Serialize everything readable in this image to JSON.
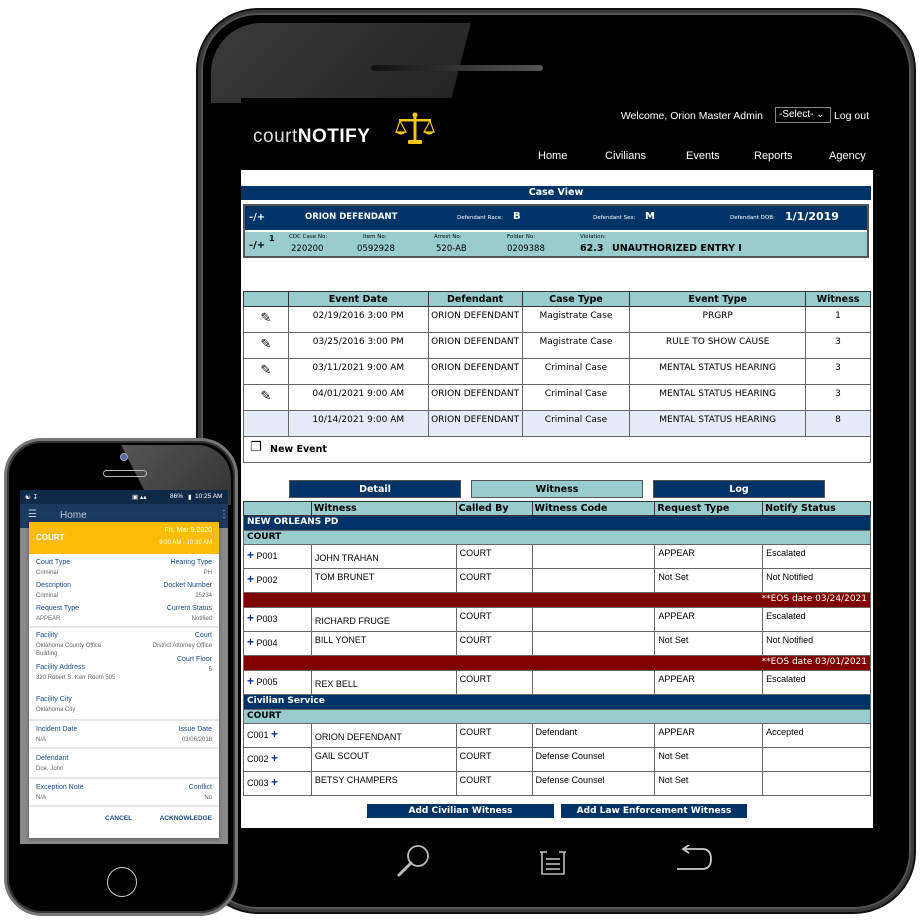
{
  "tablet": {
    "header": {
      "logo_light": "court",
      "logo_bold": "NOTIFY",
      "welcome": "Welcome, Orion Master Admin",
      "select_value": "-Select-",
      "logout": "Log out",
      "nav": [
        "Home",
        "Civilians",
        "Events",
        "Reports",
        "Agency"
      ]
    },
    "case_view": {
      "title": "Case View",
      "toggle": "-/+",
      "defendant_name": "ORION DEFENDANT",
      "race_label": "Defendant Race:",
      "race_value": "B",
      "sex_label": "Defendant Sex:",
      "sex_value": "M",
      "dob_label": "Defendant DOB:",
      "dob_value": "1/1/2019",
      "charge_toggle": "-/+",
      "charge_index": "1",
      "cdc_label": "CDC Case No:",
      "cdc_value": "220200",
      "item_label": "Item No:",
      "item_value": "0592928",
      "arrest_label": "Arrest No:",
      "arrest_value": "520-AB",
      "folder_label": "Folder No:",
      "folder_value": "0209388",
      "violation_label": "Violation:",
      "violation_code": "62.3",
      "violation_desc": "UNAUTHORIZED ENTRY I"
    },
    "events": {
      "columns": [
        "",
        "Event Date",
        "Defendant",
        "Case Type",
        "Event Type",
        "Witness"
      ],
      "rows": [
        {
          "date": "02/19/2016 3:00 PM",
          "defendant": "ORION DEFENDANT",
          "case_type": "Magistrate Case",
          "event_type": "PRGRP",
          "witness": "1",
          "editable": true
        },
        {
          "date": "03/25/2016 3:00 PM",
          "defendant": "ORION DEFENDANT",
          "case_type": "Magistrate Case",
          "event_type": "RULE TO SHOW CAUSE",
          "witness": "3",
          "editable": true
        },
        {
          "date": "03/11/2021 9:00 AM",
          "defendant": "ORION DEFENDANT",
          "case_type": "Criminal Case",
          "event_type": "MENTAL STATUS HEARING",
          "witness": "3",
          "editable": true
        },
        {
          "date": "04/01/2021 9:00 AM",
          "defendant": "ORION DEFENDANT",
          "case_type": "Criminal Case",
          "event_type": "MENTAL STATUS HEARING",
          "witness": "3",
          "editable": true
        },
        {
          "date": "10/14/2021 9:00 AM",
          "defendant": "ORION DEFENDANT",
          "case_type": "Criminal Case",
          "event_type": "MENTAL STATUS HEARING",
          "witness": "8",
          "editable": false
        }
      ],
      "new_event": "New Event"
    },
    "tabs": [
      "Detail",
      "Witness",
      "Log"
    ],
    "active_tab": "Witness",
    "witness": {
      "columns": [
        "",
        "Witness",
        "Called By",
        "Witness Code",
        "Request Type",
        "Notify Status"
      ],
      "group1": "NEW ORLEANS PD",
      "group1_sub": "COURT",
      "police": [
        {
          "id": "P001",
          "name": "JOHN TRAHAN",
          "called_by": "COURT",
          "code": "",
          "request": "APPEAR",
          "status": "Escalated"
        },
        {
          "id": "P002",
          "name": "TOM BRUNET",
          "called_by": "COURT",
          "code": "",
          "request": "Not Set",
          "status": "Not Notified"
        },
        {
          "eos": "**EOS date 03/24/2021"
        },
        {
          "id": "P003",
          "name": "RICHARD FRUGE",
          "called_by": "COURT",
          "code": "",
          "request": "APPEAR",
          "status": "Escalated"
        },
        {
          "id": "P004",
          "name": "BILL YONET",
          "called_by": "COURT",
          "code": "",
          "request": "Not Set",
          "status": "Not Notified"
        },
        {
          "eos": "**EOS date 03/01/2021"
        },
        {
          "id": "P005",
          "name": "REX BELL",
          "called_by": "COURT",
          "code": "",
          "request": "APPEAR",
          "status": "Escalated"
        }
      ],
      "group2": "Civilian Service",
      "group2_sub": "COURT",
      "civilians": [
        {
          "id": "C001",
          "name": "ORION DEFENDANT",
          "called_by": "COURT",
          "code": "Defendant",
          "request": "APPEAR",
          "status": "Accepted"
        },
        {
          "id": "C002",
          "name": "GAIL SCOUT",
          "called_by": "COURT",
          "code": "Defense Counsel",
          "request": "Not Set",
          "status": ""
        },
        {
          "id": "C003",
          "name": "BETSY CHAMPERS",
          "called_by": "COURT",
          "code": "Defense Counsel",
          "request": "Not Set",
          "status": ""
        }
      ],
      "add_civilian": "Add Civilian Witness",
      "add_law": "Add Law Enforcement Witness"
    },
    "colors": {
      "navy": "#003366",
      "teal": "#99cccc",
      "maroon": "#800000",
      "gold": "#f5c518"
    }
  },
  "phone": {
    "status_bar": {
      "battery": "86%",
      "time": "10:25 AM"
    },
    "app_title": "Home",
    "card": {
      "title": "COURT",
      "date": "Fri, Mar 9,2020",
      "time": "9:00 AM - 10:30 AM",
      "fields": {
        "court_type_label": "Court Type",
        "court_type": "Criminal",
        "hearing_type_label": "Hearing Type",
        "hearing_type": "PH",
        "description_label": "Description",
        "description": "Criminal",
        "docket_label": "Docket Number",
        "docket": "25234",
        "request_type_label": "Request Type",
        "request_type": "APPEAR",
        "current_status_label": "Current Status",
        "current_status": "Notified",
        "facility_label": "Facility",
        "facility": "Oklahoma County Office Building",
        "court_label": "Court",
        "court": "District Attorney Office",
        "court_floor_label": "Court Floor",
        "court_floor": "5",
        "facility_address_label": "Facility Address",
        "facility_address": "320 Robert S. Kerr Room 505",
        "facility_city_label": "Facility City",
        "facility_city": "Oklahoma City",
        "incident_date_label": "Incident Date",
        "incident_date": "N/A",
        "issue_date_label": "Issue Date",
        "issue_date": "03/06/2018",
        "defendant_label": "Defendant",
        "defendant": "Doe, John",
        "exception_label": "Exception Note",
        "exception": "N/A",
        "conflict_label": "Conflict",
        "conflict": "No"
      },
      "cancel": "CANCEL",
      "acknowledge": "ACKNOWLEDGE"
    },
    "colors": {
      "card_header": "#fbbc05",
      "label_blue": "#1a4a8a"
    }
  }
}
